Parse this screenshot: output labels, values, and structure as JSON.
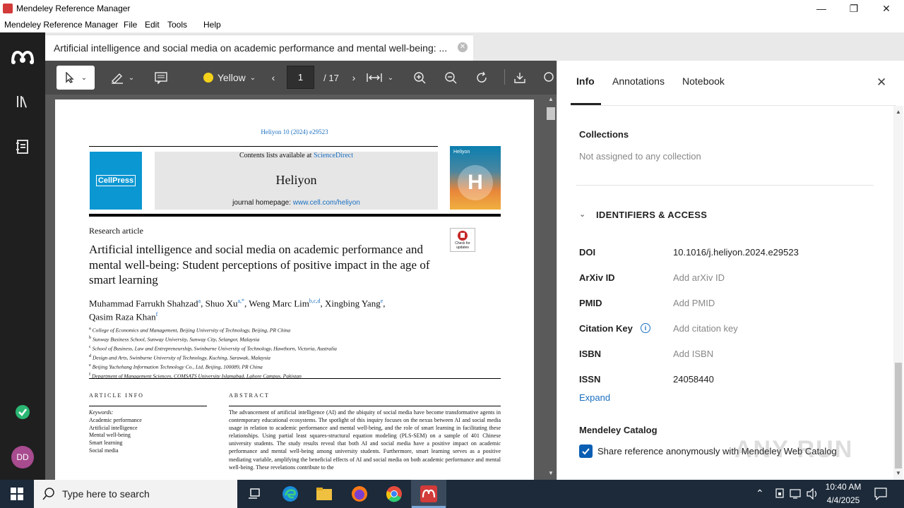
{
  "window": {
    "title": "Mendeley Reference Manager",
    "buttons": {
      "minimize": "—",
      "restore": "❐",
      "close": "✕"
    }
  },
  "menu": [
    "Mendeley Reference Manager",
    "File",
    "Edit",
    "Tools",
    "Help"
  ],
  "sidebar": {
    "items": [
      {
        "icon": "mendeley-logo-icon"
      },
      {
        "icon": "library-icon"
      },
      {
        "icon": "notebook-icon"
      },
      {
        "icon": "sync-status-icon"
      }
    ],
    "avatar_initials": "DD"
  },
  "tab": {
    "title": "Artificial intelligence and social media on academic performance and mental well-being: ..."
  },
  "pdf_toolbar": {
    "highlight_color_label": "Yellow",
    "page_current": "1",
    "page_total": "/ 17"
  },
  "pdf_page": {
    "journal_ref": "Heliyon 10 (2024) e29523",
    "contents_prefix": "Contents lists available at ",
    "contents_link": "ScienceDirect",
    "journal_name": "Heliyon",
    "homepage_prefix": "journal homepage: ",
    "homepage_link": "www.cell.com/heliyon",
    "publisher_logo": "CellPress",
    "cover_label": "Heliyon",
    "cover_letter": "H",
    "check_updates": "Check for updates",
    "article_type": "Research article",
    "article_title": "Artificial intelligence and social media on academic performance and mental well-being: Student perceptions of positive impact in the age of smart learning",
    "authors_line1": "Muhammad Farrukh Shahzad",
    "authors_sup1": "a",
    "authors_part2": ", Shuo Xu",
    "authors_sup2": "a,*",
    "authors_part3": ", Weng Marc Lim",
    "authors_sup3": "b,c,d",
    "authors_part4": ", Xingbing Yang",
    "authors_sup4": "e",
    "authors_part5": ",",
    "authors_line2": "Qasim Raza Khan",
    "authors_sup5": "f",
    "affiliations": [
      {
        "key": "a",
        "text": "College of Economics and Management, Beijing University of Technology, Beijing, PR China"
      },
      {
        "key": "b",
        "text": "Sunway Business School, Sunway University, Sunway City, Selangor, Malaysia"
      },
      {
        "key": "c",
        "text": "School of Business, Law and Entrepreneurship, Swinburne University of Technology, Hawthorn, Victoria, Australia"
      },
      {
        "key": "d",
        "text": "Design and Arts, Swinburne University of Technology, Kuching, Sarawak, Malaysia"
      },
      {
        "key": "e",
        "text": "Beijing Yuchehang Information Technology Co., Ltd, Beijing, 100089, PR China"
      },
      {
        "key": "f",
        "text": "Department of Management Sciences, COMSATS University Islamabad, Lahore Campus, Pakistan"
      }
    ],
    "article_info_heading": "ARTICLE INFO",
    "keywords_label": "Keywords:",
    "keywords": [
      "Academic performance",
      "Artificial intelligence",
      "Mental well-being",
      "Smart learning",
      "Social media"
    ],
    "abstract_heading": "ABSTRACT",
    "abstract_text": "The advancement of artificial intelligence (AI) and the ubiquity of social media have become transformative agents in contemporary educational ecosystems. The spotlight of this inquiry focuses on the nexus between AI and social media usage in relation to academic performance and mental well-being, and the role of smart learning in facilitating these relationships. Using partial least squares-structural equation modeling (PLS-SEM) on a sample of 401 Chinese university students. The study results reveal that both AI and social media have a positive impact on academic performance and mental well-being among university students. Furthermore, smart learning serves as a positive mediating variable, amplifying the beneficial effects of AI and social media on both academic performance and mental well-being. These revelations contribute to the"
  },
  "right_panel": {
    "tabs": [
      "Info",
      "Annotations",
      "Notebook"
    ],
    "active_tab": "Info",
    "collections_heading": "Collections",
    "collections_value": "Not assigned to any collection",
    "identifiers_heading": "IDENTIFIERS & ACCESS",
    "fields": [
      {
        "label": "DOI",
        "value": "10.1016/j.heliyon.2024.e29523",
        "placeholder": false
      },
      {
        "label": "ArXiv ID",
        "value": "Add arXiv ID",
        "placeholder": true
      },
      {
        "label": "PMID",
        "value": "Add PMID",
        "placeholder": true
      },
      {
        "label": "Citation Key",
        "value": "Add citation key",
        "placeholder": true
      },
      {
        "label": "ISBN",
        "value": "Add ISBN",
        "placeholder": true
      },
      {
        "label": "ISSN",
        "value": "24058440",
        "placeholder": false
      }
    ],
    "expand_label": "Expand",
    "catalog_heading": "Mendeley Catalog",
    "catalog_checkbox_label": "Share reference anonymously with Mendeley Web Catalog",
    "catalog_checked": true
  },
  "watermark": "ANY RUN",
  "taskbar": {
    "search_placeholder": "Type here to search",
    "time": "10:40 AM",
    "date": "4/4/2025"
  },
  "colors": {
    "accent": "#0a5fb4",
    "link": "#1a6fc0",
    "sidebar_bg": "#1f1f1f",
    "pdf_bg": "#5a5a5a",
    "sync_green": "#2bb673",
    "avatar_bg": "#a84b8f",
    "taskbar_bg": "#1c2a3a",
    "highlight_yellow": "#f5d21a"
  }
}
